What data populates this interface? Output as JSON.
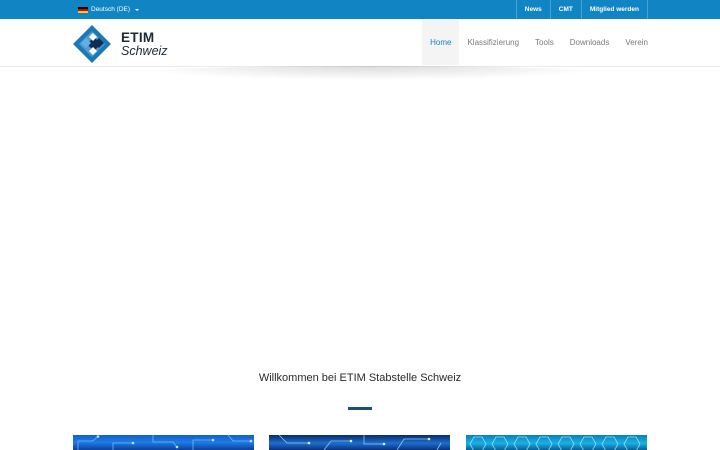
{
  "topbar": {
    "language": "Deutsch (DE)",
    "links": [
      "News",
      "CMT",
      "Mitglied werden"
    ]
  },
  "logo": {
    "title": "ETIM",
    "subtitle": "Schweiz"
  },
  "nav": {
    "items": [
      "Home",
      "Klassifizierung",
      "Tools",
      "Downloads",
      "Verein"
    ],
    "active": "Home"
  },
  "welcome": {
    "heading": "Willkommen bei ETIM Stabstelle Schweiz"
  },
  "colors": {
    "topbar": "#1185c4",
    "active_nav": "#1185c4",
    "divider": "#1d4f73"
  }
}
